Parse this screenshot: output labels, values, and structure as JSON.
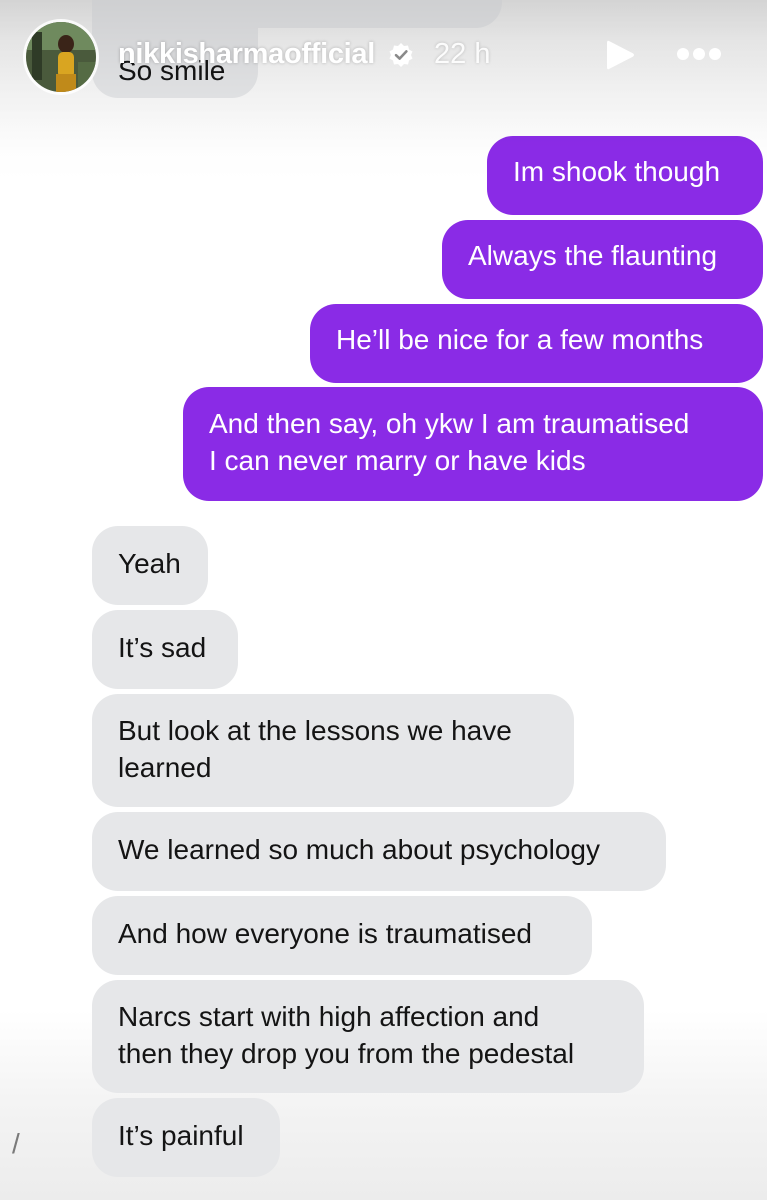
{
  "story": {
    "username": "nikkisharmaofficial",
    "time": "22 h",
    "icons": {
      "avatar": "profile-avatar",
      "verified": "verified-badge-icon",
      "play": "play-icon",
      "more": "more-options-icon"
    }
  },
  "messages": {
    "partial_top": "So smile",
    "sent": [
      "Im shook though",
      "Always the flaunting",
      "He’ll be nice for a few months",
      [
        "And then say, oh ykw I am traumatised",
        "I can never marry or have kids"
      ]
    ],
    "received": [
      "Yeah",
      "It’s sad",
      [
        "But look at the lessons we have",
        "learned"
      ],
      "We learned so much about psychology",
      "And how everyone is traumatised",
      [
        "Narcs start with high affection and",
        "then they drop you from the pedestal"
      ],
      "It’s painful"
    ]
  },
  "stray_glyph": "/",
  "colors": {
    "sent_bubble": "#8a2be6",
    "received_bubble": "#e6e7e9",
    "text_dark": "#141414"
  }
}
